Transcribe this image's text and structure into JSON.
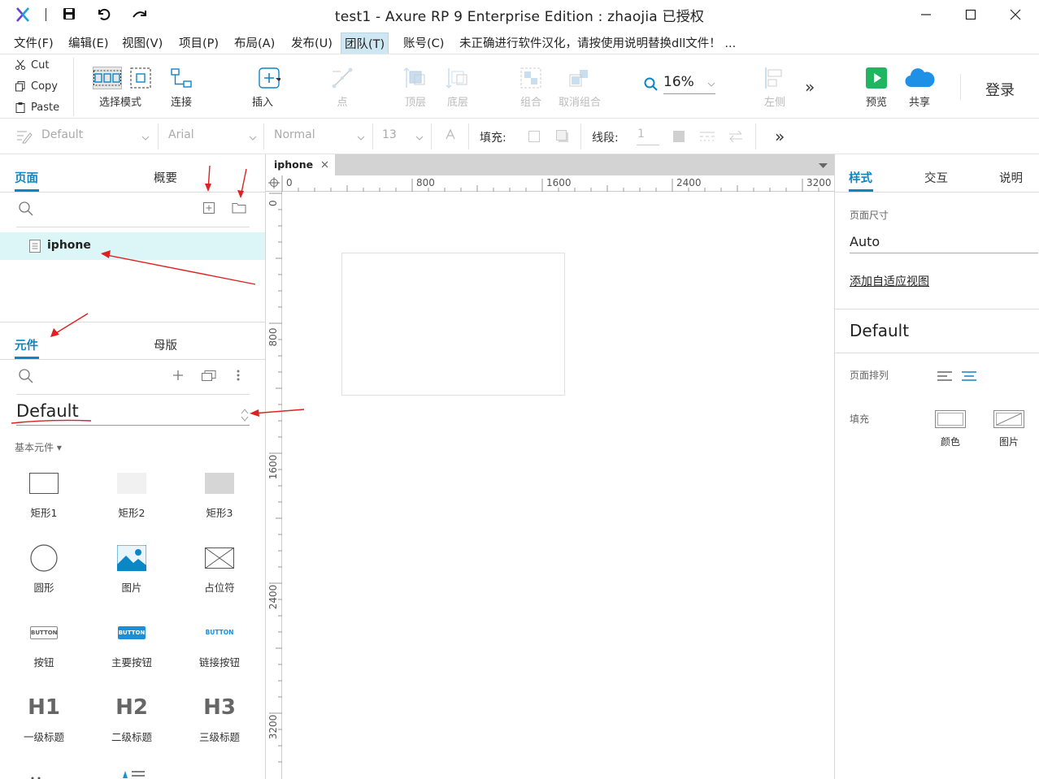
{
  "window": {
    "title": "test1 - Axure RP 9 Enterprise Edition : zhaojia 已授权"
  },
  "menu": {
    "items": [
      {
        "label": "文件(F)"
      },
      {
        "label": "编辑(E)"
      },
      {
        "label": "视图(V)"
      },
      {
        "label": "项目(P)"
      },
      {
        "label": "布局(A)"
      },
      {
        "label": "发布(U)"
      },
      {
        "label": "团队(T)"
      },
      {
        "label": "账号(C)"
      }
    ],
    "notice": "未正确进行软件汉化，请按使用说明替换dll文件！ ..."
  },
  "clipboard": {
    "cut": "Cut",
    "copy": "Copy",
    "paste": "Paste"
  },
  "toolbar": {
    "select_mode": "选择模式",
    "connect": "连接",
    "insert": "插入",
    "point": "点",
    "top_layer": "顶层",
    "bottom_layer": "底层",
    "group": "组合",
    "ungroup": "取消组合",
    "zoom": "16%",
    "align_left": "左侧",
    "more": "»",
    "preview": "预览",
    "share": "共享",
    "login": "登录"
  },
  "format": {
    "style": "Default",
    "font": "Arial",
    "weight": "Normal",
    "size": "13",
    "fill_label": "填充:",
    "stroke_label": "线段:",
    "stroke_value": "1",
    "more": "»"
  },
  "pages_panel": {
    "tabs": [
      "页面",
      "概要"
    ],
    "pages": [
      {
        "name": "iphone"
      }
    ]
  },
  "widgets_panel": {
    "tabs": [
      "元件",
      "母版"
    ],
    "library": "Default",
    "category": "基本元件 ▾",
    "items": [
      {
        "label": "矩形1"
      },
      {
        "label": "矩形2"
      },
      {
        "label": "矩形3"
      },
      {
        "label": "圆形"
      },
      {
        "label": "图片"
      },
      {
        "label": "占位符"
      },
      {
        "label": "按钮",
        "icon_text": "BUTTON"
      },
      {
        "label": "主要按钮",
        "icon_text": "BUTTON"
      },
      {
        "label": "链接按钮",
        "icon_text": "BUTTON"
      },
      {
        "label": "一级标题",
        "icon_text": "H1"
      },
      {
        "label": "二级标题",
        "icon_text": "H2"
      },
      {
        "label": "三级标题",
        "icon_text": "H3"
      }
    ]
  },
  "canvas": {
    "tab": "iphone",
    "ruler_h": [
      "0",
      "800",
      "1600",
      "2400",
      "3200"
    ],
    "ruler_v": [
      "0",
      "800",
      "1600",
      "2400",
      "3200"
    ]
  },
  "inspector": {
    "tabs": [
      "样式",
      "交互",
      "说明"
    ],
    "page_size_label": "页面尺寸",
    "page_size_value": "Auto",
    "adaptive_link": "添加自适应视图",
    "style_name": "Default",
    "page_align_label": "页面排列",
    "fill_label": "填充",
    "fill_color": "颜色",
    "fill_image": "图片"
  },
  "colors": {
    "accent": "#0d86c7",
    "annotation": "#e02020",
    "preview_green": "#1fb561",
    "share_blue": "#1e90e6"
  }
}
